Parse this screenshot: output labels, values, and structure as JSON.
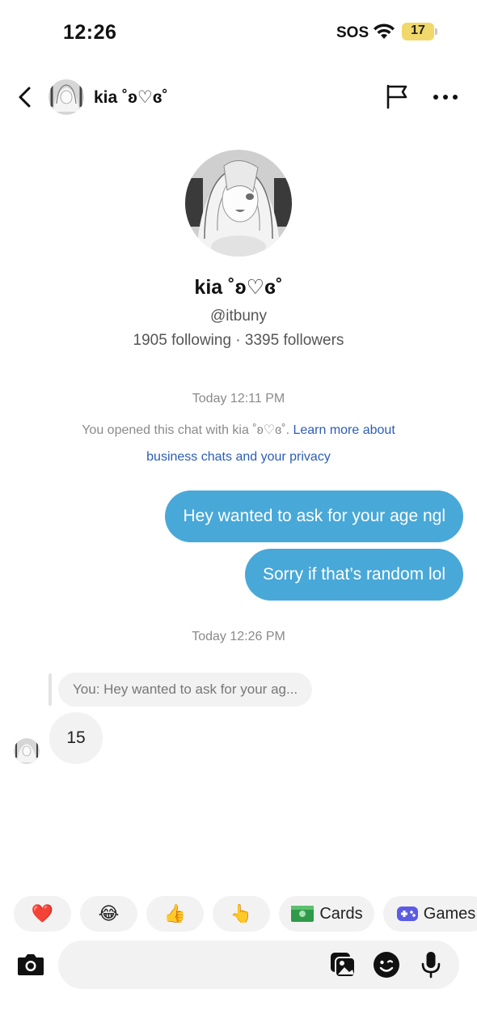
{
  "status_bar": {
    "time": "12:26",
    "sos": "SOS",
    "battery": "17",
    "battery_color": "#f1d86a"
  },
  "header": {
    "contact_name": "kia ˚ʚ♡ɞ˚"
  },
  "profile": {
    "name": "kia ˚ʚ♡ɞ˚",
    "handle": "@itbuny",
    "stats": "1905 following · 3395 followers"
  },
  "chat": {
    "timestamp_1": "Today 12:11 PM",
    "privacy_text": "You opened this chat with kia ˚ʚ♡ɞ˚. ",
    "privacy_link": "Learn more about business chats and your privacy",
    "outgoing": [
      "Hey wanted to ask for your age ngl",
      "Sorry if that’s random lol"
    ],
    "timestamp_2": "Today 12:26 PM",
    "reply_quote": "You: Hey wanted to ask for your ag...",
    "incoming": "15",
    "outgoing_bubble_color": "#48a8d8",
    "link_color": "#2c5db5"
  },
  "quick_replies": [
    {
      "emoji": "❤️",
      "icon": "heart-icon"
    },
    {
      "emoji": "😂",
      "icon": "laughing-emoji-icon"
    },
    {
      "emoji": "👍",
      "icon": "thumbs-up-icon"
    },
    {
      "emoji": "👆",
      "icon": "pointing-up-icon"
    },
    {
      "label": "Cards",
      "icon": "card-icon"
    },
    {
      "label": "Games",
      "icon": "gamepad-icon"
    }
  ],
  "composer": {
    "placeholder": ""
  }
}
